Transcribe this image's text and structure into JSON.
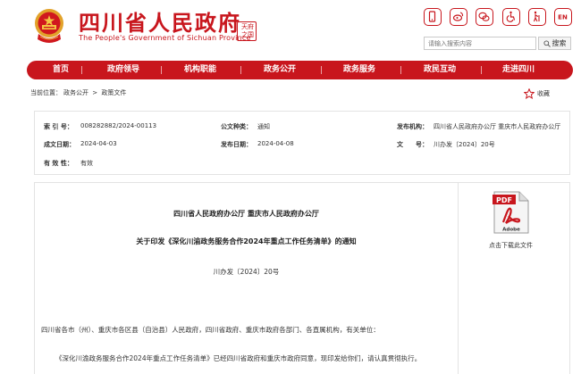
{
  "header": {
    "title": "四川省人民政府",
    "subtitle": "The People's Government of Sichuan Province",
    "seal_text": "天府\n之国",
    "brand_color": "#c8161d",
    "icons": [
      "mobile-icon",
      "weibo-icon",
      "wechat-icon",
      "accessibility-icon",
      "elderly-icon",
      "english-icon"
    ],
    "english_icon_text": "EN"
  },
  "search": {
    "placeholder": "请输入搜索内容",
    "button_label": "搜索"
  },
  "nav": {
    "items": [
      {
        "label": "首页"
      },
      {
        "label": "政府领导"
      },
      {
        "label": "机构职能"
      },
      {
        "label": "政务公开"
      },
      {
        "label": "政务服务"
      },
      {
        "label": "政民互动"
      },
      {
        "label": "走进四川"
      }
    ]
  },
  "breadcrumb": {
    "prefix": "当前位置：",
    "level1": "政务公开",
    "sep": ">",
    "level2": "政策文件"
  },
  "favorite_label": "收藏",
  "meta": {
    "index_label": "索 引 号：",
    "index_value": "008282882/2024-00113",
    "category_label": "公文种类：",
    "category_value": "通知",
    "issuer_label": "发布机构：",
    "issuer_value": "四川省人民政府办公厅 重庆市人民政府办公厅",
    "created_label": "成文日期：",
    "created_value": "2024-04-03",
    "published_label": "发布日期：",
    "published_value": "2024-04-08",
    "docno_label": "文　　号：",
    "docno_value": "川办发〔2024〕20号",
    "validity_label": "有 效 性：",
    "validity_value": "有效"
  },
  "article": {
    "issuer": "四川省人民政府办公厅  重庆市人民政府办公厅",
    "title": "关于印发《深化川渝政务服务合作2024年重点工作任务清单》的通知",
    "doc_number": "川办发〔2024〕20号",
    "para1": "四川省各市（州）、重庆市各区县（自治县）人民政府，四川省政府、重庆市政府各部门、各直属机构，有关单位：",
    "para2": "《深化川渝政务服务合作2024年重点工作任务清单》已经四川省政府和重庆市政府同意，现印发给你们，请认真贯彻执行。"
  },
  "pdf": {
    "badge": "PDF",
    "brand": "Adobe",
    "download_label": "点击下载此文件"
  }
}
